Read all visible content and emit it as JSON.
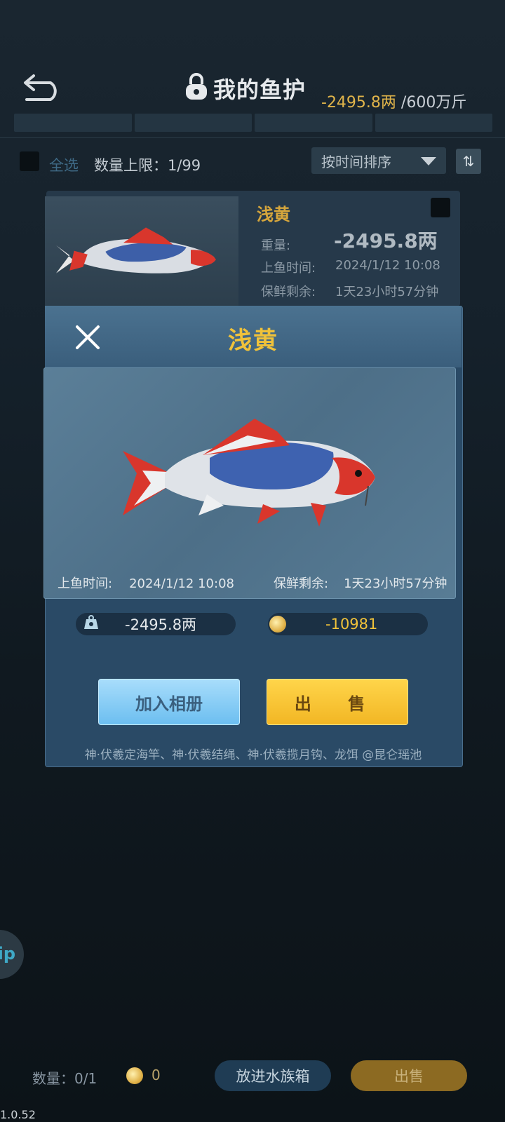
{
  "header": {
    "back_icon": "back-arrow-icon",
    "lock_icon": "lock-icon",
    "title": "我的鱼护",
    "capacity_current": "-2495.8两",
    "capacity_total": " /600万斤"
  },
  "filter": {
    "select_all": "全选",
    "limit": "数量上限：1/99",
    "sort_label": "按时间排序",
    "sort_toggle_icon": "sort-order-icon"
  },
  "list_card": {
    "name": "浅黄",
    "weight_label": "重量:",
    "weight_value": "-2495.8两",
    "time_label": "上鱼时间:",
    "time_value": "2024/1/12  10:08",
    "fresh_label": "保鲜剩余:",
    "fresh_value": "1天23小时57分钟"
  },
  "modal": {
    "close_icon": "close-icon",
    "title": "浅黄",
    "time_label": "上鱼时间:",
    "time_value": "2024/1/12  10:08",
    "fresh_label": "保鲜剩余:",
    "fresh_value": "1天23小时57分钟",
    "weight_icon": "scale-weight-icon",
    "weight_value": "-2495.8两",
    "coin_icon": "coin-icon",
    "coin_value": "-10981",
    "album_button": "加入相册",
    "sell_button": "出 售",
    "bait_info": "神·伏羲定海竿、神·伏羲结绳、神·伏羲揽月钩、龙饵 @昆仑瑶池"
  },
  "side_bubble": "ip",
  "footer": {
    "quantity": "数量：0/1",
    "coin_icon": "coin-icon",
    "coin_count": "0",
    "aquarium_button": "放进水族箱",
    "sell_button": "出售"
  },
  "version": "1.0.52",
  "colors": {
    "gold_text": "#f0c23a",
    "sell_button": "#f2b624",
    "album_button": "#6cbef0"
  }
}
